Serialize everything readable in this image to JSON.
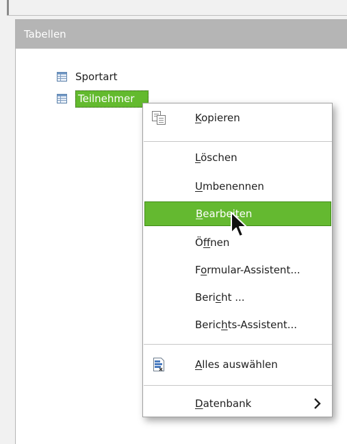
{
  "panel": {
    "header": "Tabellen"
  },
  "tree": {
    "items": [
      {
        "label": "Sportart",
        "selected": false,
        "icon": "table-icon"
      },
      {
        "label": "Teilnehmer",
        "selected": true,
        "icon": "table-icon"
      }
    ]
  },
  "context_menu": {
    "items": [
      {
        "pre": "",
        "mnemonic": "K",
        "post": "opieren",
        "icon": "copy-icon"
      },
      {
        "pre": "",
        "mnemonic": "L",
        "post": "öschen"
      },
      {
        "pre": "",
        "mnemonic": "U",
        "post": "mbenennen"
      },
      {
        "pre": "",
        "mnemonic": "B",
        "post": "earbeiten",
        "highlighted": true
      },
      {
        "pre": "Ö",
        "mnemonic": "f",
        "post": "fnen"
      },
      {
        "pre": "F",
        "mnemonic": "o",
        "post": "rmular-Assistent..."
      },
      {
        "pre": "Beri",
        "mnemonic": "c",
        "post": "ht ..."
      },
      {
        "pre": "Beric",
        "mnemonic": "h",
        "post": "ts-Assistent..."
      },
      {
        "pre": "",
        "mnemonic": "A",
        "post": "lles auswählen",
        "icon": "select-all-icon"
      },
      {
        "pre": "",
        "mnemonic": "D",
        "post": "atenbank",
        "submenu": true
      }
    ]
  },
  "colors": {
    "accent": "#63ba2e",
    "header_bg": "#b5b5b5"
  }
}
